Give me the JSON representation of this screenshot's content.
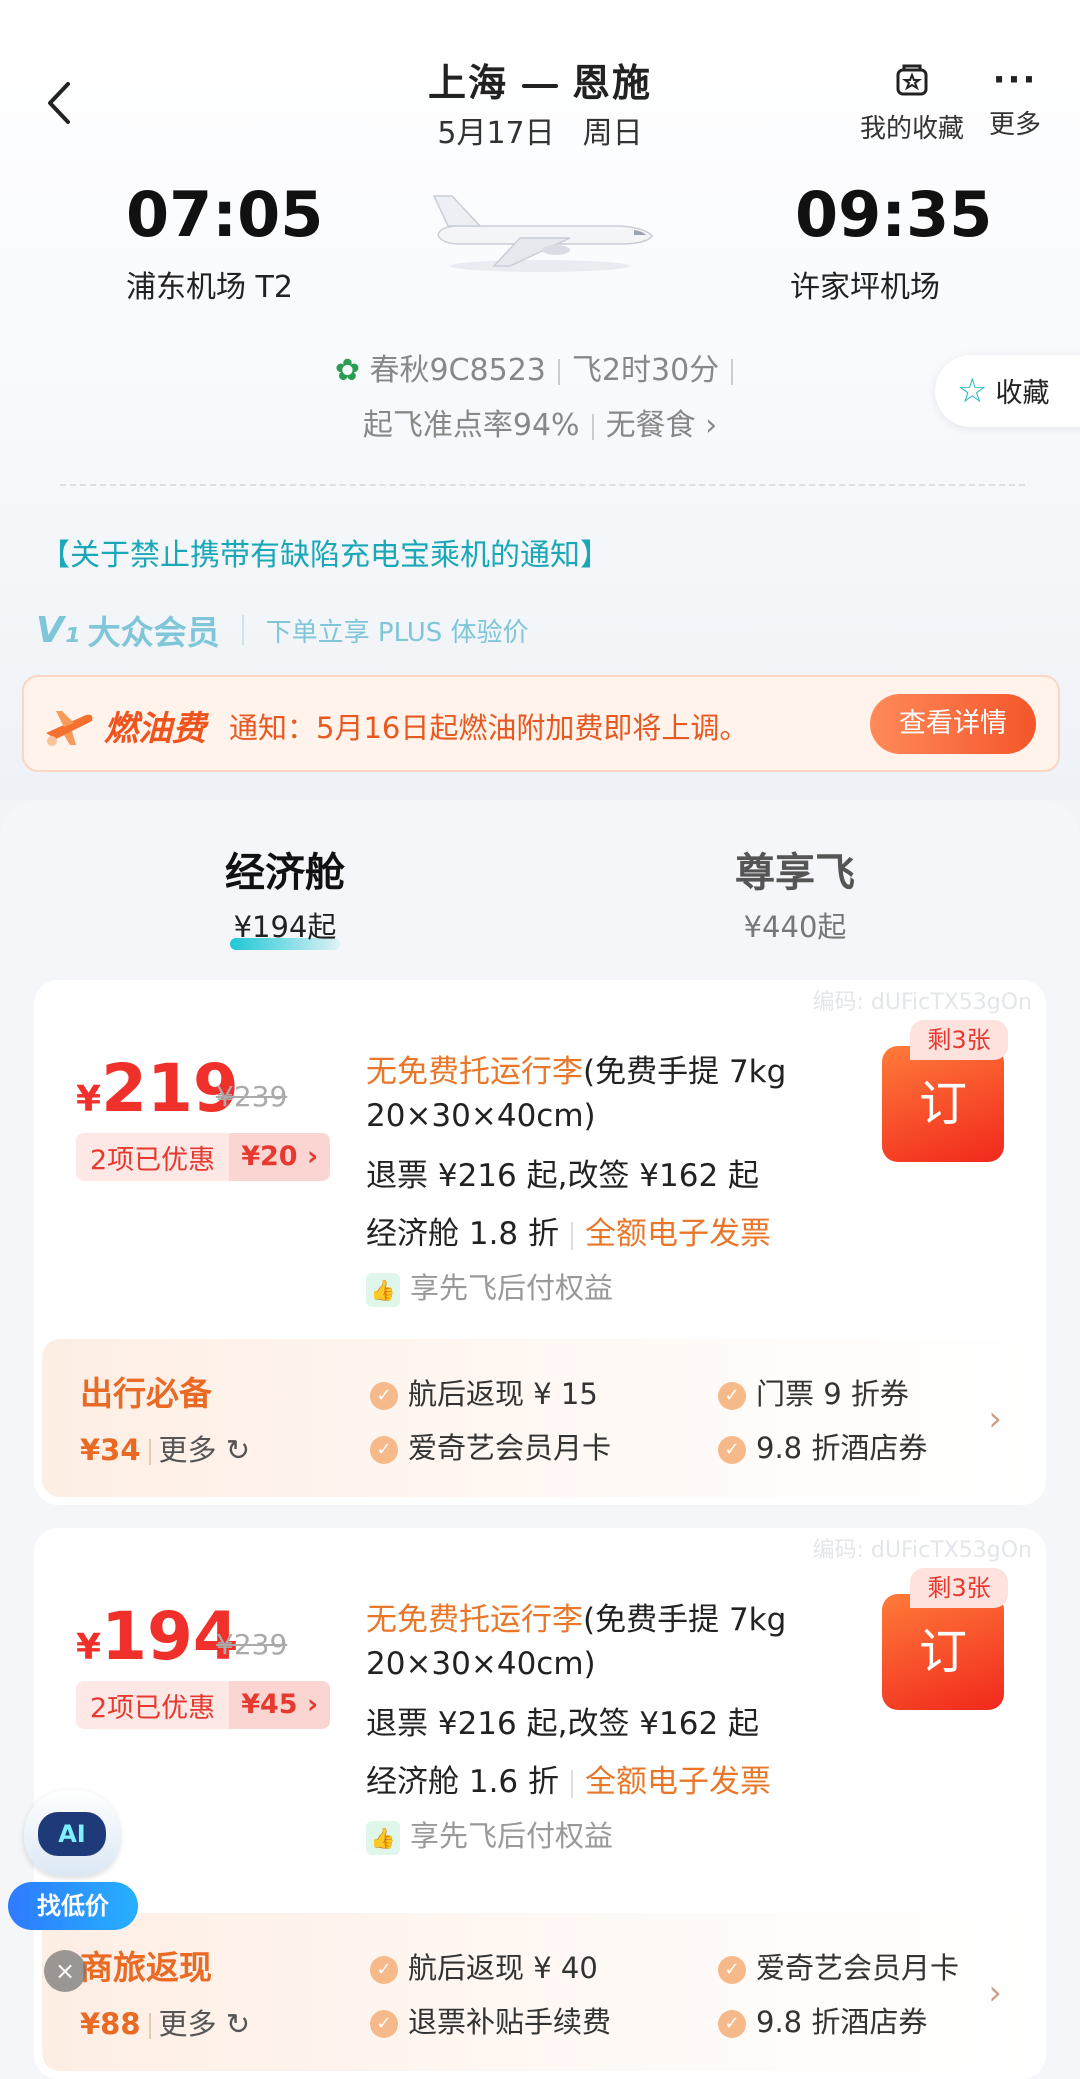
{
  "header": {
    "origin": "上海",
    "destination": "恩施",
    "date": "5月17日",
    "weekday": "周日",
    "favorites_label": "我的收藏",
    "more_label": "更多",
    "more_icon": "···"
  },
  "flight": {
    "dep_time": "07:05",
    "dep_airport": "浦东机场 T2",
    "arr_time": "09:35",
    "arr_airport": "许家坪机场",
    "airline_flight": "春秋9C8523",
    "duration": "飞2时30分",
    "ontime": "起飞准点率94%",
    "meal": "无餐食",
    "meal_chevron": "›",
    "favorite_label": "收藏"
  },
  "notice": "【关于禁止携带有缺陷充电宝乘机的通知】",
  "vip": {
    "logo": "V₁",
    "name": "大众会员",
    "desc": "下单立享 PLUS 体验价"
  },
  "fuel": {
    "title": "燃油费",
    "text": "通知：5月16日起燃油附加费即将上调。",
    "button": "查看详情"
  },
  "tabs": [
    {
      "label": "经济舱",
      "price": "¥194起"
    },
    {
      "label": "尊享飞",
      "price": "¥440起"
    }
  ],
  "fares": [
    {
      "code": "编码: dUFicTX53gOn",
      "currency": "¥",
      "price": "219",
      "orig_price": "¥239",
      "discount_label": "2项已优惠",
      "discount_amount": "¥20 ›",
      "baggage": "无免费托运行李",
      "carry_on": "(免费手提 7kg 20×30×40cm)",
      "refund": "退票 ¥216 起,改签 ¥162 起",
      "cabin_discount": "经济舱 1.8 折",
      "invoice": "全额电子发票",
      "benefit": "享先飞后付权益",
      "remaining": "剩3张",
      "book": "订",
      "extras_title": "出行必备",
      "extras_price": "¥34",
      "extras_more": "更多 ↻",
      "extras_items": [
        "航后返现 ¥ 15",
        "门票 9 折券",
        "爱奇艺会员月卡",
        "9.8 折酒店券"
      ]
    },
    {
      "code": "编码: dUFicTX53gOn",
      "currency": "¥",
      "price": "194",
      "orig_price": "¥239",
      "discount_label": "2项已优惠",
      "discount_amount": "¥45 ›",
      "baggage": "无免费托运行李",
      "carry_on": "(免费手提 7kg 20×30×40cm)",
      "refund": "退票 ¥216 起,改签 ¥162 起",
      "cabin_discount": "经济舱 1.6 折",
      "invoice": "全额电子发票",
      "benefit": "享先飞后付权益",
      "remaining": "剩3张",
      "book": "订",
      "extras_title": "商旅返现",
      "extras_price": "¥88",
      "extras_more": "更多 ↻",
      "extras_items": [
        "航后返现 ¥ 40",
        "爱奇艺会员月卡",
        "退票补贴手续费",
        "9.8 折酒店券"
      ]
    }
  ],
  "ai": {
    "face": "AI",
    "button": "找低价",
    "close": "×"
  }
}
